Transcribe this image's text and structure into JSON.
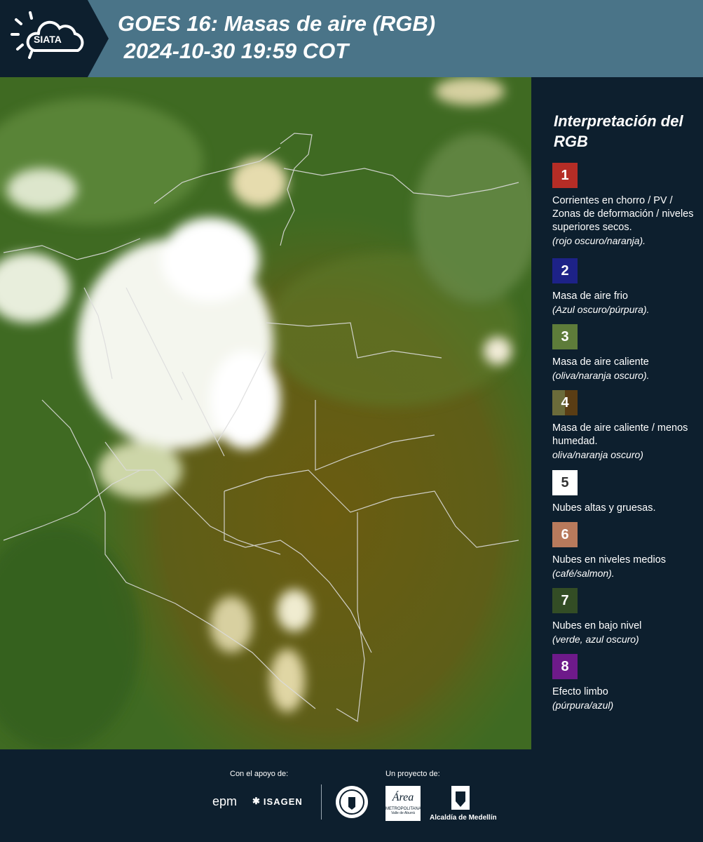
{
  "header": {
    "logo_text": "SIATA",
    "title_line1": "GOES 16: Masas de aire (RGB)",
    "title_line2": " 2024-10-30 19:59 COT"
  },
  "legend": {
    "title": "Interpretación del RGB",
    "items": [
      {
        "number": "1",
        "color": "#b52d26",
        "text": "Corrientes en chorro / PV / Zonas de deformación / niveles superiores secos.",
        "note": "(rojo oscuro/naranja)."
      },
      {
        "number": "2",
        "color": "#1d2287",
        "text": "Masa de aire frio",
        "note": "(Azul oscuro/púrpura)."
      },
      {
        "number": "3",
        "color": "#5e7c3a",
        "text": "Masa de aire caliente",
        "note": "(oliva/naranja oscuro)."
      },
      {
        "number": "4",
        "color": "#6b5a2c",
        "text": "Masa de aire caliente / menos humedad.",
        "note": "oliva/naranja oscuro)"
      },
      {
        "number": "5",
        "color": "#ffffff",
        "text": "Nubes altas y gruesas.",
        "note": ""
      },
      {
        "number": "6",
        "color": "#b87a5c",
        "text": "Nubes en niveles medios",
        "note": "(café/salmon)."
      },
      {
        "number": "7",
        "color": "#334d25",
        "text": "Nubes en bajo nivel",
        "note": "(verde, azul oscuro)"
      },
      {
        "number": "8",
        "color": "#6e1a8a",
        "text": "Efecto limbo",
        "note": "(púrpura/azul)"
      }
    ]
  },
  "footer": {
    "support_label": "Con el apoyo de:",
    "project_label": "Un proyecto de:",
    "brand_epm": "epm",
    "brand_isagen": "ISAGEN",
    "brand_area_line1": "Área",
    "brand_area_line2": "METROPOLITANA",
    "brand_area_line3": "Valle de Aburrá",
    "brand_alcaldia": "Alcaldía de Medellín"
  }
}
